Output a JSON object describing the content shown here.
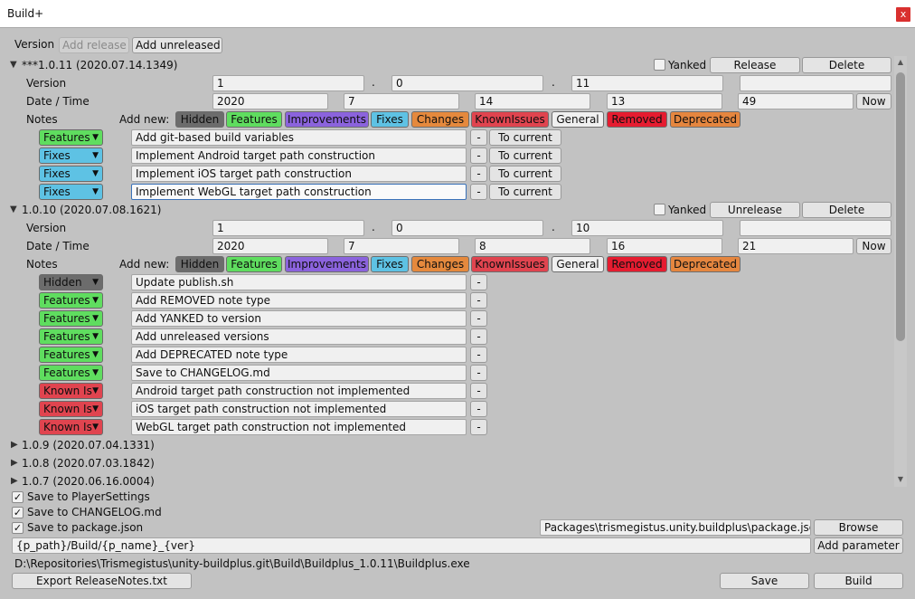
{
  "window": {
    "title": "Build+",
    "close": "x"
  },
  "version_bar": {
    "label": "Version",
    "add_release": "Add release",
    "add_unreleased": "Add unreleased"
  },
  "field_labels": {
    "version": "Version",
    "datetime": "Date / Time",
    "notes": "Notes",
    "add_new": "Add new:"
  },
  "common": {
    "remove": "-",
    "to_current": "To current",
    "now": "Now",
    "yanked": "Yanked",
    "delete": "Delete",
    "dot": "."
  },
  "note_types": {
    "hidden": "Hidden",
    "features": "Features",
    "improvements": "Improvements",
    "fixes": "Fixes",
    "changes": "Changes",
    "known_issues": "KnownIssues",
    "general": "General",
    "removed": "Removed",
    "deprecated": "Deprecated"
  },
  "colors": {
    "hidden": "#6c6c6c",
    "features": "#5fdd5f",
    "improvements": "#8b63dd",
    "fixes": "#5ec2e4",
    "changes": "#e5893d",
    "known_issues": "#e0444f",
    "general": "#f0f0f0",
    "removed": "#e51c30",
    "deprecated": "#e5863f"
  },
  "releases": [
    {
      "header": "***1.0.11 (2020.07.14.1349)",
      "release_button": "Release",
      "version": [
        "1",
        "0",
        "11",
        ""
      ],
      "datetime": [
        "2020",
        "7",
        "14",
        "13",
        "49"
      ],
      "notes": [
        {
          "type": "Features",
          "text": "Add git-based build variables"
        },
        {
          "type": "Fixes",
          "text": "Implement Android target path construction"
        },
        {
          "type": "Fixes",
          "text": "Implement iOS target path construction"
        },
        {
          "type": "Fixes",
          "text": "Implement WebGL target path construction"
        }
      ]
    },
    {
      "header": "1.0.10 (2020.07.08.1621)",
      "release_button": "Unrelease",
      "version": [
        "1",
        "0",
        "10",
        ""
      ],
      "datetime": [
        "2020",
        "7",
        "8",
        "16",
        "21"
      ],
      "notes": [
        {
          "type": "Hidden",
          "text": "Update publish.sh"
        },
        {
          "type": "Features",
          "text": "Add REMOVED note type"
        },
        {
          "type": "Features",
          "text": "Add YANKED to version"
        },
        {
          "type": "Features",
          "text": "Add unreleased versions"
        },
        {
          "type": "Features",
          "text": "Add DEPRECATED note type"
        },
        {
          "type": "Features",
          "text": "Save to CHANGELOG.md"
        },
        {
          "type": "Known Is",
          "text": "Android target path construction not implemented"
        },
        {
          "type": "Known Is",
          "text": "iOS target path construction not implemented"
        },
        {
          "type": "Known Is",
          "text": "WebGL target path construction not implemented"
        }
      ]
    }
  ],
  "collapsed_releases": [
    "1.0.9 (2020.07.04.1331)",
    "1.0.8 (2020.07.03.1842)",
    "1.0.7 (2020.06.16.0004)"
  ],
  "options": {
    "save_player_settings": "Save to PlayerSettings",
    "save_changelog": "Save to CHANGELOG.md",
    "save_package_json": "Save to package.json"
  },
  "package_path": "Packages\\trismegistus.unity.buildplus\\package.json",
  "browse": "Browse",
  "build_path_template": "{p_path}/Build/{p_name}_{ver}",
  "add_parameter": "Add parameter",
  "resolved_path": "D:\\Repositories\\Trismegistus\\unity-buildplus.git\\Build\\Buildplus_1.0.11\\Buildplus.exe",
  "footer": {
    "export": "Export ReleaseNotes.txt",
    "save": "Save",
    "build": "Build"
  },
  "scrollbar": {
    "up_icon": "▲",
    "down_icon": "▼"
  },
  "glyphs": {
    "expanded": "▼",
    "collapsed": "▶",
    "check": "✓",
    "dropdown": "▼"
  }
}
